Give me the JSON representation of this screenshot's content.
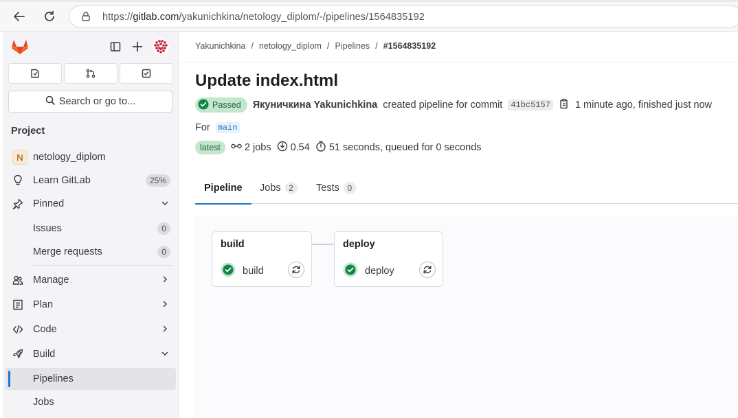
{
  "browser": {
    "url_prefix": "https://",
    "url_host": "gitlab.com",
    "url_path": "/yakunichkina/netology_diplom/-/pipelines/1564835192"
  },
  "sidebar": {
    "search_label": "Search or go to...",
    "section_title": "Project",
    "project_initial": "N",
    "project_name": "netology_diplom",
    "learn": {
      "label": "Learn GitLab",
      "badge": "25%"
    },
    "pinned": {
      "label": "Pinned"
    },
    "pinned_items": [
      {
        "label": "Issues",
        "count": "0"
      },
      {
        "label": "Merge requests",
        "count": "0"
      }
    ],
    "manage": "Manage",
    "plan": "Plan",
    "code": "Code",
    "build": "Build",
    "build_items": [
      "Pipelines",
      "Jobs"
    ]
  },
  "breadcrumb": [
    "Yakunichkina",
    "netology_diplom",
    "Pipelines",
    "#1564835192"
  ],
  "pipeline": {
    "title": "Update index.html",
    "status": "Passed",
    "author": "Якуничкина Yakunichkina",
    "action_text": "created pipeline for commit",
    "commit_sha": "41bc5157",
    "time_text": "1 minute ago, finished just now",
    "for_label": "For",
    "ref": "main",
    "latest_label": "latest",
    "jobs_count": "2 jobs",
    "coverage": "0.54",
    "duration": "51 seconds, queued for 0 seconds"
  },
  "tabs": [
    {
      "label": "Pipeline"
    },
    {
      "label": "Jobs",
      "badge": "2"
    },
    {
      "label": "Tests",
      "badge": "0"
    }
  ],
  "stages": [
    {
      "name": "build",
      "job": "build"
    },
    {
      "name": "deploy",
      "job": "deploy"
    }
  ],
  "colors": {
    "accent": "#1f75cb",
    "success": "#108548",
    "gitlab_orange": "#e24329"
  }
}
